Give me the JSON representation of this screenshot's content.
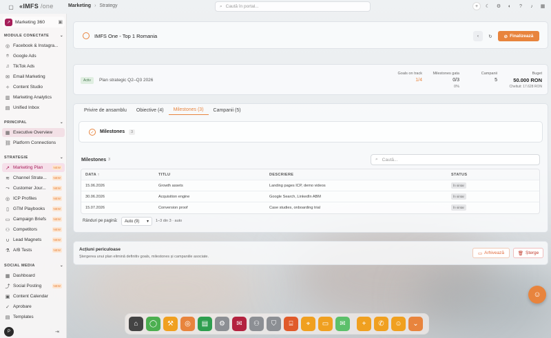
{
  "app": {
    "logo_main": "IMFS",
    "logo_suffix": "/one"
  },
  "breadcrumb": {
    "root": "Marketing",
    "current": "Strategy"
  },
  "search": {
    "placeholder": "Caută în portal..."
  },
  "workspace": {
    "name": "Marketing 360"
  },
  "sidebar": {
    "sections": [
      {
        "title": "MODULE CONECTATE"
      },
      {
        "title": "PRINCIPAL"
      },
      {
        "title": "STRATEGIE"
      },
      {
        "title": "SOCIAL MEDIA"
      }
    ],
    "connected": [
      "Facebook & Instagra...",
      "Google Ads",
      "TikTok Ads",
      "Email Marketing",
      "Content Studio",
      "Marketing Analytics",
      "Unified Inbox"
    ],
    "principal": [
      "Executive Overview",
      "Platform Connections"
    ],
    "strategie": [
      "Marketing Plan",
      "Channel Strate...",
      "Customer Jour...",
      "ICP Profiles",
      "GTM Playbooks",
      "Campaign Briefs",
      "Competitors",
      "Lead Magnets",
      "A/B Tests"
    ],
    "social": [
      "Dashboard",
      "Social Posting",
      "Content Calendar",
      "Aprobare",
      "Templates"
    ],
    "new_label": "NEW",
    "user_initial": "P"
  },
  "plan": {
    "title": "IMFS One - Top 1 Romania",
    "finalize_label": "Finalizează",
    "status": "Activ",
    "subtitle": "Plan strategic Q2–Q3 2026",
    "stats": {
      "goals_label": "Goals on track",
      "goals_value": "1/4",
      "milestones_label": "Milestones gata",
      "milestones_value": "0/3",
      "milestones_pct": "0%",
      "campaigns_label": "Campanii",
      "campaigns_value": "5",
      "budget_label": "Buget",
      "budget_value": "50.000 RON",
      "spent": "Cheltuit: 17.628 RON"
    }
  },
  "tabs": [
    {
      "label": "Privire de ansamblu"
    },
    {
      "label": "Obiective (4)"
    },
    {
      "label": "Milestones (3)"
    },
    {
      "label": "Campanii (5)"
    }
  ],
  "milestones_header": {
    "title": "Milestones",
    "count": "3"
  },
  "table": {
    "title": "Milestones",
    "count": "3",
    "search_placeholder": "Caută...",
    "columns": [
      "DATA",
      "TITLU",
      "DESCRIERE",
      "STATUS"
    ],
    "rows": [
      {
        "date": "15.06.2026",
        "title": "Growth assets",
        "desc": "Landing pages ICP, demo videos",
        "status": "În sintar"
      },
      {
        "date": "30.06.2026",
        "title": "Acquisition engine",
        "desc": "Google Search, LinkedIn ABM",
        "status": "În sintar"
      },
      {
        "date": "15.07.2026",
        "title": "Conversion proof",
        "desc": "Case studies, onboarding trial",
        "status": "În sintar"
      }
    ],
    "rows_per_page_label": "Rânduri pe pagină:",
    "rows_per_page_value": "Auto (9)",
    "range": "1–3 din 3 · auto"
  },
  "danger": {
    "title": "Acțiuni periculoase",
    "desc": "Ștergerea unui plan elimină definitiv goals, milestones și campaniile asociate.",
    "archive_label": "Arhivează",
    "delete_label": "Șterge"
  },
  "colors": {
    "accent": "#e8843d",
    "brand": "#a61f5a"
  }
}
